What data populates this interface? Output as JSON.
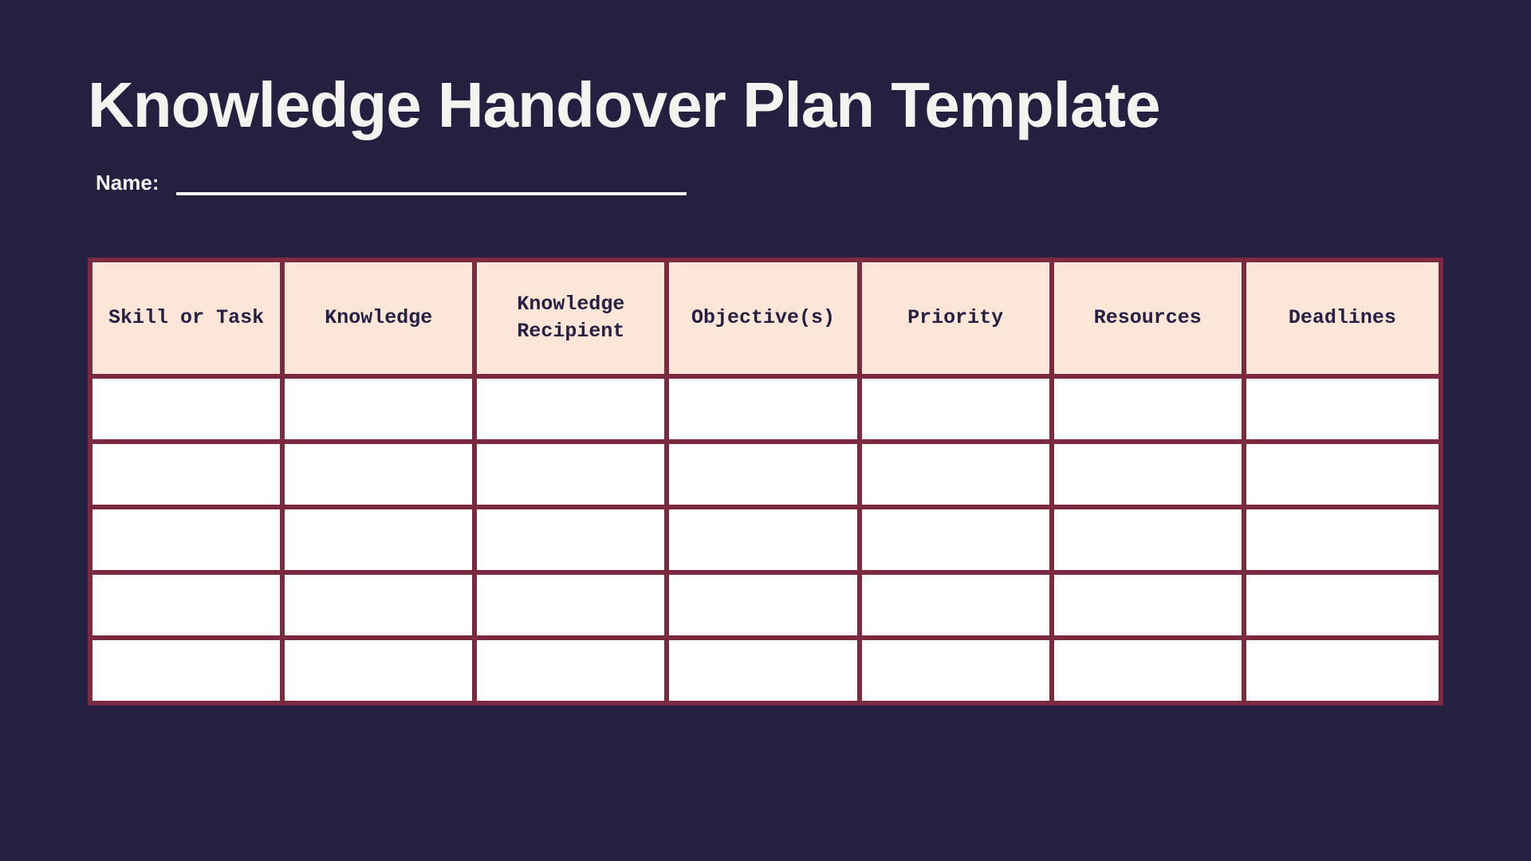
{
  "title": "Knowledge Handover Plan Template",
  "name_label": "Name:",
  "name_value": "",
  "table": {
    "headers": [
      "Skill or Task",
      "Knowledge",
      "Knowledge Recipient",
      "Objective(s)",
      "Priority",
      "Resources",
      "Deadlines"
    ],
    "rows": [
      [
        "",
        "",
        "",
        "",
        "",
        "",
        ""
      ],
      [
        "",
        "",
        "",
        "",
        "",
        "",
        ""
      ],
      [
        "",
        "",
        "",
        "",
        "",
        "",
        ""
      ],
      [
        "",
        "",
        "",
        "",
        "",
        "",
        ""
      ],
      [
        "",
        "",
        "",
        "",
        "",
        "",
        ""
      ]
    ]
  }
}
